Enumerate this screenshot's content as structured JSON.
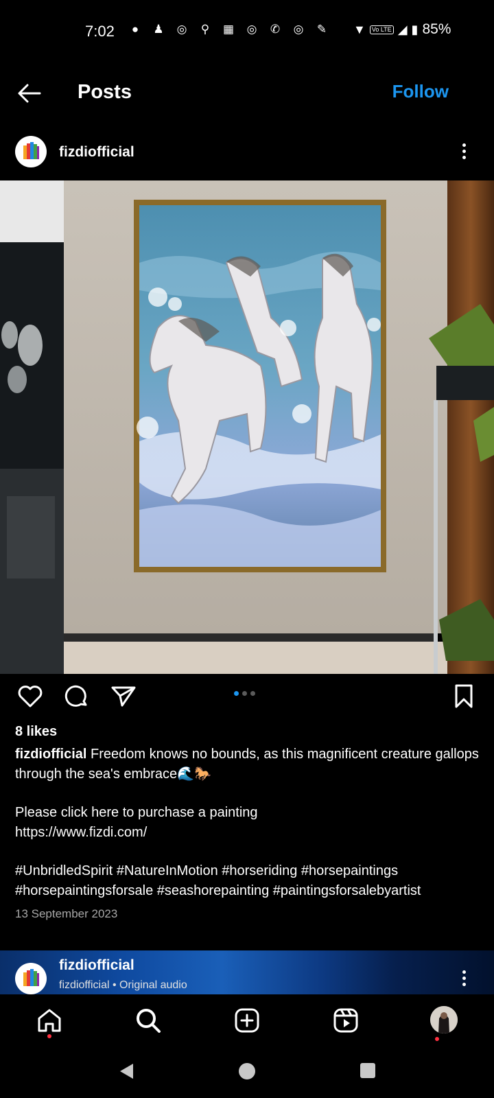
{
  "status": {
    "time": "7:02",
    "battery": "85%",
    "network_badge": "Vo LTE"
  },
  "topbar": {
    "title": "Posts",
    "follow_label": "Follow"
  },
  "post": {
    "username": "fizdiofficial",
    "likes": "8 likes",
    "caption_user": "fizdiofficial",
    "caption_line1": "Freedom knows no bounds, as this magnificent creature gallops through the sea's embrace🌊🐎",
    "caption_line2": "Please click here to purchase a painting",
    "caption_line3": "https://www.fizdi.com/",
    "caption_hashtags": "#UnbridledSpirit #NatureInMotion #horseriding #horsepaintings #horsepaintingsforsale #seashorepainting #paintingsforsalebyartist",
    "date": "13 September 2023",
    "carousel_pages": 3,
    "carousel_active": 1
  },
  "next_post": {
    "username": "fizdiofficial",
    "subtitle": "fizdiofficial • Original audio"
  },
  "colors": {
    "accent": "#1c96f0",
    "notification": "#ff3040",
    "background": "#000000"
  },
  "icons": {
    "back": "arrow-left-icon",
    "more": "more-vertical-icon",
    "like": "heart-icon",
    "comment": "comment-icon",
    "share": "send-icon",
    "save": "bookmark-icon",
    "home": "home-icon",
    "search": "search-icon",
    "create": "plus-square-icon",
    "reels": "reels-icon",
    "profile": "profile-avatar"
  }
}
